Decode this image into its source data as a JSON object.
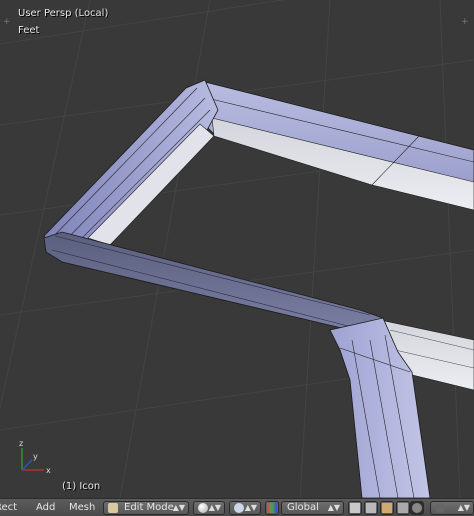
{
  "viewport": {
    "view_name": "User Persp (Local)",
    "units": "Feet",
    "object_info": "(1) Icon",
    "axis_labels": {
      "x": "x",
      "y": "y",
      "z": "z"
    }
  },
  "header": {
    "menus": [
      "Rect",
      "Add",
      "Mesh"
    ],
    "mode": "Edit Mode",
    "orientation": "Global"
  },
  "icons": {
    "mode_icon": "edit-mode-icon",
    "shading": "sphere-icon",
    "pivot": "pivot-icon",
    "manipulator": "transform-manipulator-icon",
    "snap": "snap-icon",
    "proportional": "proportional-edit-icon"
  },
  "colors": {
    "viewport_bg": "#393939",
    "mesh_face": "#a8acd8",
    "mesh_face_light": "#d8dae8",
    "header_bg": "#4f4f4f"
  }
}
